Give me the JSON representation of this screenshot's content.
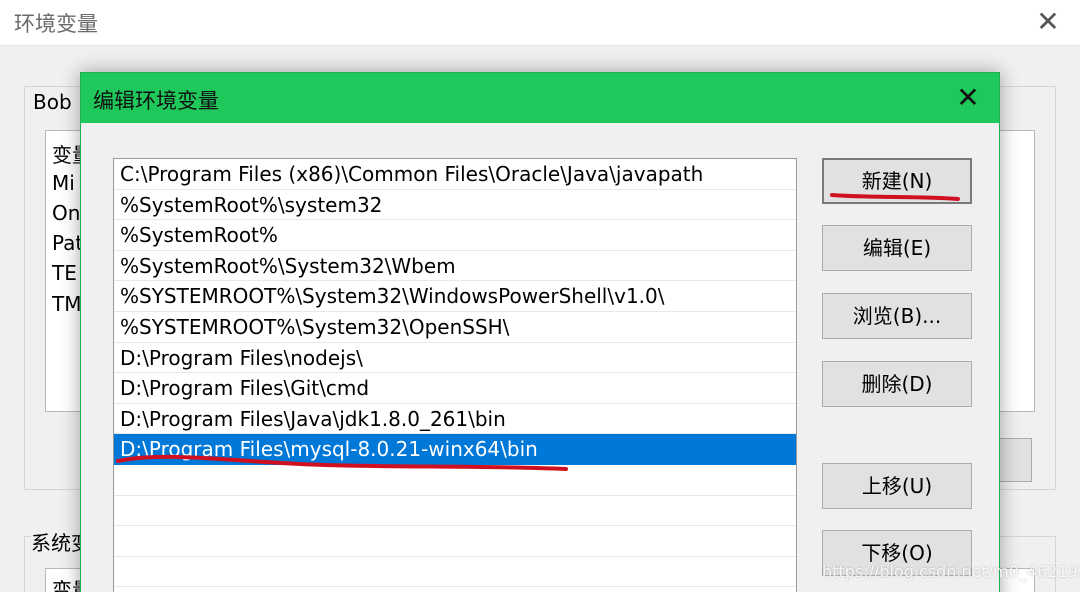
{
  "background_window": {
    "title": "环境变量",
    "close_glyph": "✕",
    "user_section_label": "Bob",
    "user_list_items": [
      "变量",
      "Mi",
      "On",
      "Pat",
      "TE",
      "TM"
    ],
    "system_section_label": "系统变",
    "system_list_header": "变量"
  },
  "dialog": {
    "title": "编辑环境变量",
    "close_glyph": "✕",
    "paths": [
      "C:\\Program Files (x86)\\Common Files\\Oracle\\Java\\javapath",
      "%SystemRoot%\\system32",
      "%SystemRoot%",
      "%SystemRoot%\\System32\\Wbem",
      "%SYSTEMROOT%\\System32\\WindowsPowerShell\\v1.0\\",
      "%SYSTEMROOT%\\System32\\OpenSSH\\",
      "D:\\Program Files\\nodejs\\",
      "D:\\Program Files\\Git\\cmd",
      "D:\\Program Files\\Java\\jdk1.8.0_261\\bin",
      "D:\\Program Files\\mysql-8.0.21-winx64\\bin"
    ],
    "selected_index": 9,
    "buttons": {
      "new": "新建(N)",
      "edit": "编辑(E)",
      "browse": "浏览(B)...",
      "delete": "删除(D)",
      "move_up": "上移(U)",
      "move_down": "下移(O)"
    },
    "annotation_color": "#d01020",
    "selection_color": "#0078d7",
    "titlebar_color": "#1ec85a"
  },
  "watermark": "https://blog.csdn.net/m0_46219251"
}
